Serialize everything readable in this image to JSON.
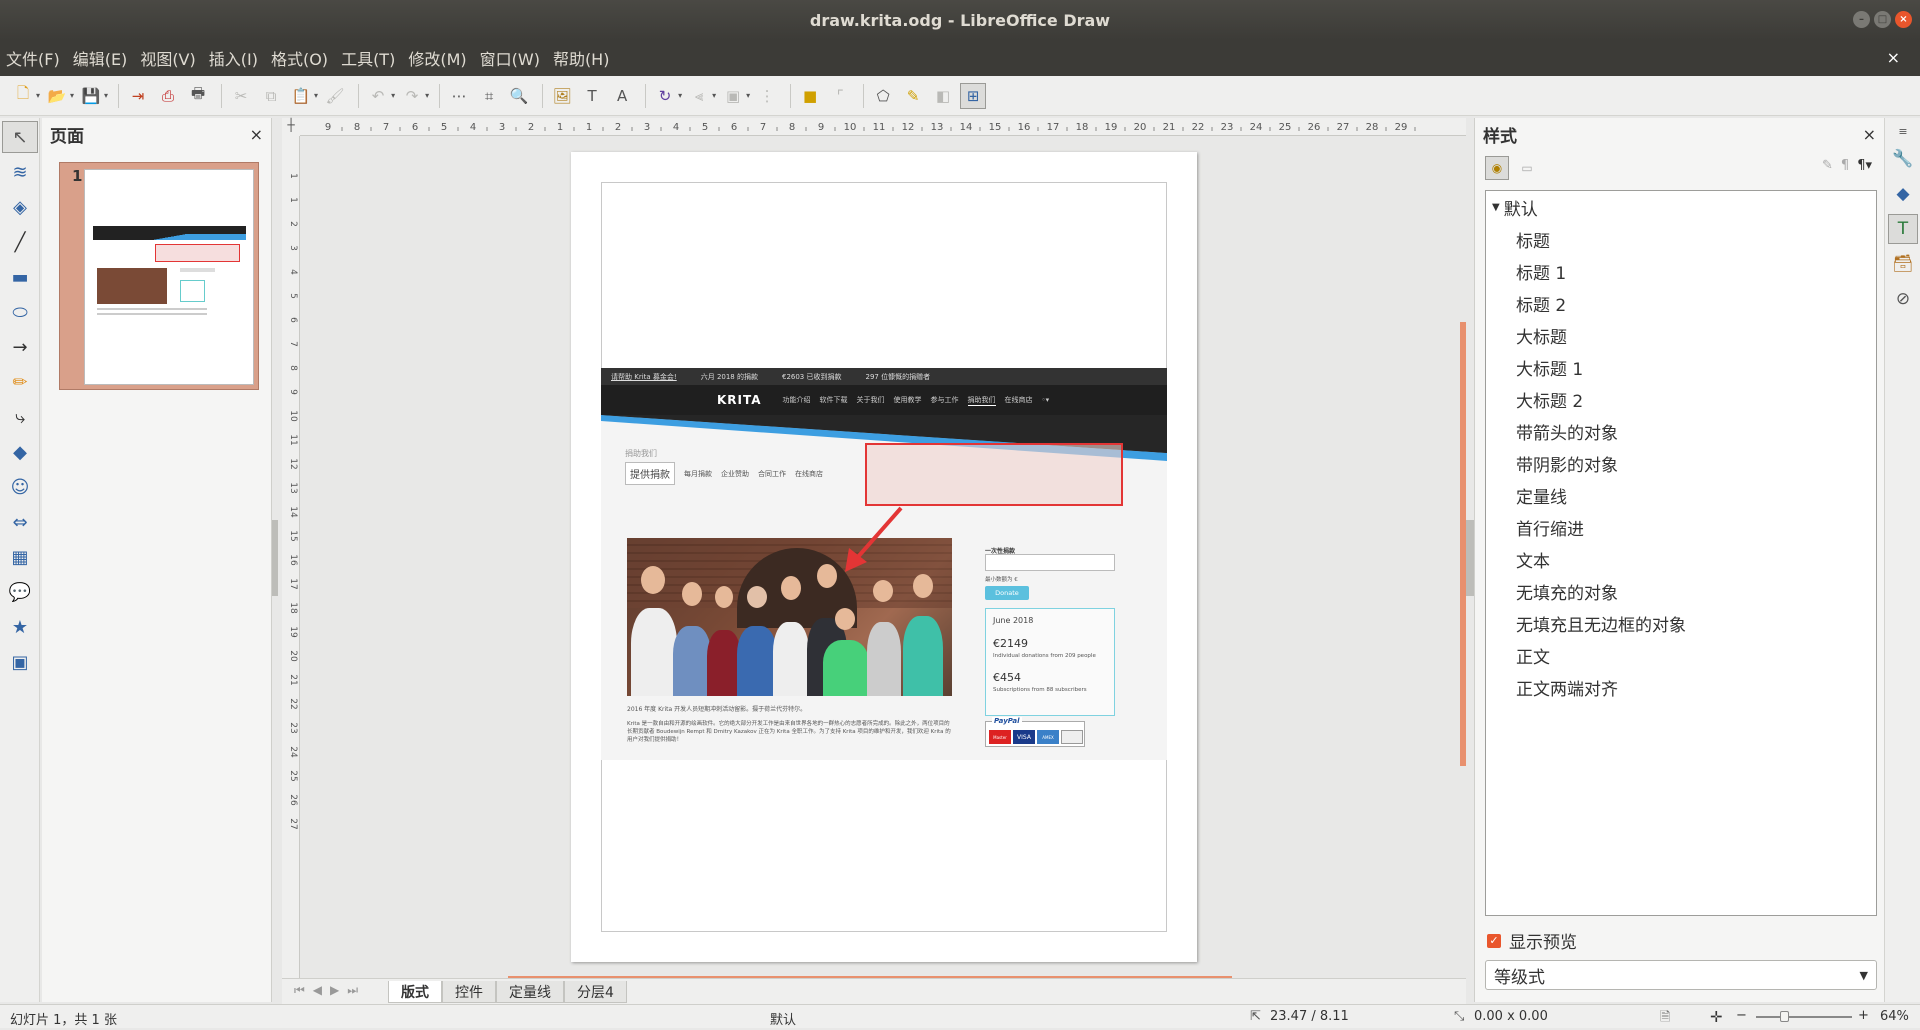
{
  "window": {
    "title": "draw.krita.odg - LibreOffice Draw"
  },
  "menu": [
    "文件(F)",
    "编辑(E)",
    "视图(V)",
    "插入(I)",
    "格式(O)",
    "工具(T)",
    "修改(M)",
    "窗口(W)",
    "帮助(H)"
  ],
  "pages_panel": {
    "title": "页面",
    "page_number": "1"
  },
  "ruler": {
    "h_ticks": [
      "9",
      "8",
      "7",
      "6",
      "5",
      "4",
      "3",
      "2",
      "1",
      "1",
      "2",
      "3",
      "4",
      "5",
      "6",
      "7",
      "8",
      "9",
      "10",
      "11",
      "12",
      "13",
      "14",
      "15",
      "16",
      "17",
      "18",
      "19",
      "20",
      "21",
      "22",
      "23",
      "24",
      "25",
      "26",
      "27",
      "28",
      "29"
    ],
    "v_ticks": [
      "1",
      "1",
      "2",
      "3",
      "4",
      "5",
      "6",
      "7",
      "8",
      "9",
      "10",
      "11",
      "12",
      "13",
      "14",
      "15",
      "16",
      "17",
      "18",
      "19",
      "20",
      "21",
      "22",
      "23",
      "24",
      "25",
      "26",
      "27"
    ]
  },
  "krita_page": {
    "donation_bar": [
      "请帮助 Krita 募金会!",
      "六月 2018 的捐款",
      "€2603 已收到捐款",
      "297 位慷慨的捐赠者"
    ],
    "logo": "KRITA",
    "nav": [
      "功能介绍",
      "软件下载",
      "关于我们",
      "使用教学",
      "参与工作",
      "捐助我们",
      "在线商店"
    ],
    "breadcrumb": "捐助我们",
    "subtabs": [
      "提供捐款",
      "每月捐款",
      "企业赞助",
      "合同工作",
      "在线商店"
    ],
    "one_time_label": "一次性捐款",
    "min_amount": "最小数额为 €",
    "donate_button": "Donate",
    "month_box": {
      "title": "June 2018",
      "amount1": "€2149",
      "desc1": "Individual donations from 209 people",
      "amount2": "€454",
      "desc2": "Subscriptions from 88 subscribers"
    },
    "photo_caption": "2016 年度 Krita 开发人员短期冲刺活动留影。摄于荷兰代芬特尔。",
    "body_text": "Krita 是一款自由和开源的绘画软件。它的绝大部分开发工作是由来自世界各地的一群热心的志愿者所完成的。除此之外，两位项目的长期贡献者 Boudewijn Rempt 和 Dmitry Kazakov 正在为 Krita 全职工作。为了支持 Krita 项目的维护和开发，我们欢迎 Krita 的用户对我们提供捐助！",
    "paypal": "PayPal",
    "cards": [
      "Master",
      "VISA",
      "AMEX"
    ]
  },
  "layer_tabs": [
    "版式",
    "控件",
    "定量线",
    "分层4"
  ],
  "styles_panel": {
    "title": "样式",
    "items": [
      "默认",
      "标题",
      "标题 1",
      "标题 2",
      "大标题",
      "大标题 1",
      "大标题 2",
      "带箭头的对象",
      "带阴影的对象",
      "定量线",
      "首行缩进",
      "文本",
      "无填充的对象",
      "无填充且无边框的对象",
      "正文",
      "正文两端对齐"
    ],
    "show_preview": "显示预览",
    "filter": "等级式"
  },
  "status": {
    "slide": "幻灯片 1，共 1 张",
    "layout": "默认",
    "position": "23.47 / 8.11",
    "size": "0.00 x 0.00",
    "zoom": "64%"
  },
  "colors": {
    "accent": "#e8906e",
    "red_annot": "#e33535",
    "krita_blue": "#3d9ee1"
  }
}
